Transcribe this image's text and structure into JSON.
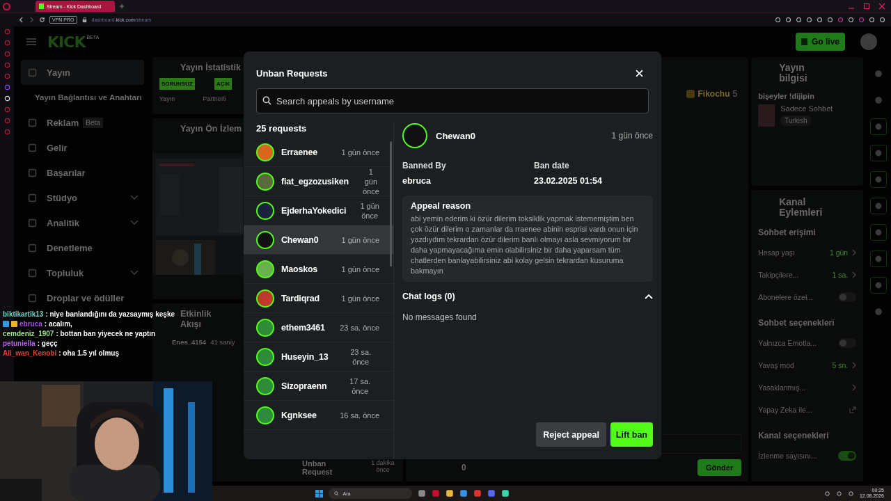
{
  "browser": {
    "tab_title": "Stream - Kick Dashboard",
    "vpn_badge": "VPN PRO",
    "url": "dashboard.**kick.com**/stream"
  },
  "header": {
    "logo": "KICK",
    "logo_badge": "BETA",
    "go_live": "Go live"
  },
  "nav": [
    {
      "label": "Yayın",
      "selected": true,
      "sub": false,
      "expandable": false
    },
    {
      "label": "Yayın Bağlantısı ve Anahtarı",
      "selected": false,
      "sub": true,
      "expandable": false
    },
    {
      "label": "Reklam",
      "badge": "Beta",
      "selected": false,
      "sub": false,
      "expandable": false
    },
    {
      "label": "Gelir",
      "selected": false,
      "sub": false,
      "expandable": false
    },
    {
      "label": "Başarılar",
      "selected": false,
      "sub": false,
      "expandable": false
    },
    {
      "label": "Stüdyo",
      "selected": false,
      "sub": false,
      "expandable": true
    },
    {
      "label": "Analitik",
      "selected": false,
      "sub": false,
      "expandable": true
    },
    {
      "label": "Denetleme",
      "selected": false,
      "sub": false,
      "expandable": false
    },
    {
      "label": "Topluluk",
      "selected": false,
      "sub": false,
      "expandable": true
    },
    {
      "label": "Droplar ve ödüller",
      "selected": false,
      "sub": false,
      "expandable": false
    }
  ],
  "stats_panel": {
    "title": "Yayın İstatistik",
    "tags": [
      "SORUNSUZ",
      "AÇIK"
    ],
    "labels": [
      "Yayın",
      "Partnerli"
    ]
  },
  "preview_panel": {
    "title": "Yayın Ön İzlem"
  },
  "activity_panel": {
    "title": "Etkinlik Akışı",
    "user": "Enes_4154",
    "time": "41 saniy",
    "last_event": {
      "title": "Unban Request",
      "time": "1 dakika önce"
    }
  },
  "chat": {
    "top_user": "Fikochu",
    "top_count": "5",
    "counter": "0",
    "send": "Gönder"
  },
  "info_panel": {
    "title": "Yayın bilgisi",
    "stream_title": "bişeyler !dijipin",
    "category": "Sadece Sohbet",
    "language": "Turkish"
  },
  "actions_panel": {
    "title": "Kanal Eylemleri",
    "sections": [
      {
        "heading": "Sohbet erişimi",
        "rows": [
          {
            "label": "Hesap yaşı",
            "kind": "value",
            "value": "1 gün"
          },
          {
            "label": "Takipçilere...",
            "kind": "value",
            "value": "1 sa."
          },
          {
            "label": "Abonelere özel...",
            "kind": "toggle",
            "on": false
          }
        ]
      },
      {
        "heading": "Sohbet seçenekleri",
        "rows": [
          {
            "label": "Yalnızca Emotla...",
            "kind": "toggle",
            "on": false
          },
          {
            "label": "Yavaş mod",
            "kind": "value",
            "value": "5 sn."
          },
          {
            "label": "Yasaklanmış...",
            "kind": "link"
          },
          {
            "label": "Yapay Zeka ile...",
            "kind": "external"
          }
        ]
      },
      {
        "heading": "Kanal seçenekleri",
        "rows": [
          {
            "label": "İzlenme sayısını...",
            "kind": "toggle",
            "on": true
          }
        ]
      }
    ]
  },
  "modal": {
    "title": "Unban Requests",
    "search": {
      "placeholder": "Search appeals by username"
    },
    "count": "25 requests",
    "requests": [
      {
        "name": "Erraenee",
        "time": "1 gün önce",
        "selected": false
      },
      {
        "name": "fiat_egzozusiken",
        "time": "1 gün önce",
        "selected": false
      },
      {
        "name": "EjderhaYokedici",
        "time": "1 gün önce",
        "selected": false
      },
      {
        "name": "Chewan0",
        "time": "1 gün önce",
        "selected": true
      },
      {
        "name": "Maoskos",
        "time": "1 gün önce",
        "selected": false
      },
      {
        "name": "Tardiqrad",
        "time": "1 gün önce",
        "selected": false
      },
      {
        "name": "ethem3461",
        "time": "23 sa. önce",
        "selected": false
      },
      {
        "name": "Huseyin_13",
        "time": "23 sa. önce",
        "selected": false
      },
      {
        "name": "Sizopraenn",
        "time": "17 sa. önce",
        "selected": false
      },
      {
        "name": "Kgnksee",
        "time": "16 sa. önce",
        "selected": false
      }
    ],
    "detail": {
      "name": "Chewan0",
      "time": "1 gün önce",
      "banned_by_label": "Banned By",
      "banned_by": "ebruca",
      "ban_date_label": "Ban date",
      "ban_date": "23.02.2025 01:54",
      "reason_title": "Appeal reason",
      "reason": "abi yemin ederim ki özür dilerim toksiklik yapmak istememiştim ben çok özür dilerim o zamanlar da rraenee abinin esprisi vardı onun için yazdıydım tekrardan özür dilerim banlı olmayı asla sevmiyorum bir daha yapmayacağıma emin olabilirsiniz bir daha yaparsam tüm chatlerden banlayabilirsiniz abi kolay gelsin tekrardan kusuruma bakmayın",
      "chat_logs_title": "Chat logs (0)",
      "chat_logs_expanded": true,
      "chat_logs_empty": "No messages found"
    },
    "buttons": {
      "reject": "Reject appeal",
      "lift": "Lift ban"
    }
  },
  "stream_chat": [
    {
      "user": "biktikartik13",
      "color": "#6fd6c6",
      "message": ": niye banlandığını da yazsaymış keşke",
      "badges": false
    },
    {
      "user": "ebruca",
      "color": "#a653e0",
      "message": ": acalım,",
      "badges": true
    },
    {
      "user": "cemdeniz_1907",
      "color": "#9ee88c",
      "message": ": bottan ban yiyecek ne yaptın",
      "badges": false
    },
    {
      "user": "petuniella",
      "color": "#b864e6",
      "message": ": geçç",
      "badges": false
    },
    {
      "user": "Ali_wan_Kenobi",
      "color": "#e5412c",
      "message": ": oha 1.5 yıl olmuş",
      "badges": false
    }
  ],
  "taskbar": {
    "search": "Ara",
    "time": "00:25",
    "date": "12.08.2026"
  }
}
